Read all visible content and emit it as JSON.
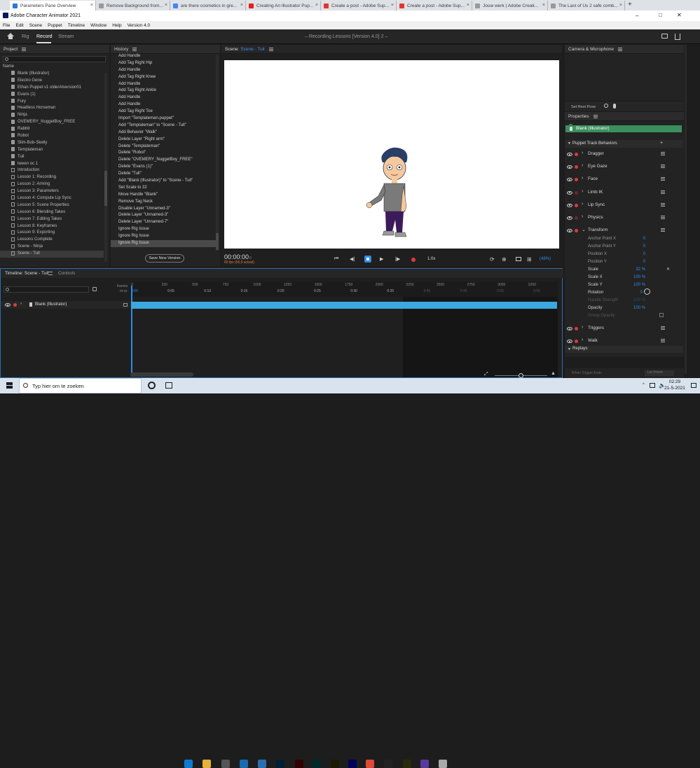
{
  "browser_tabs": [
    {
      "title": "Parameters Pane Overview",
      "color": "#2a7bd6"
    },
    {
      "title": "Remove Background from...",
      "color": "#999999"
    },
    {
      "title": "are there cosmetics in gre...",
      "color": "#4285f4"
    },
    {
      "title": "Creating An Illustrator Pup...",
      "color": "#e62117"
    },
    {
      "title": "Create a post - Adobe Sup...",
      "color": "#e3342f"
    },
    {
      "title": "Create a post - Adobe Sup...",
      "color": "#e3342f"
    },
    {
      "title": "Jouw werk | Adobe Creati...",
      "color": "#999999"
    },
    {
      "title": "The Last of Us 2 safe comb...",
      "color": "#999999"
    }
  ],
  "window": {
    "title": "Adobe Character Animator 2021",
    "controls": [
      "–",
      "□",
      "✕"
    ]
  },
  "menu": [
    "File",
    "Edit",
    "Scene",
    "Puppet",
    "Timeline",
    "Window",
    "Help",
    "Version 4.0"
  ],
  "modes": {
    "rig": "Rig",
    "record": "Record",
    "stream": "Stream"
  },
  "doc_title": "– Recording Lessons [Version 4.0] 2 –",
  "project": {
    "header": "Project",
    "col_name": "Name",
    "items": [
      "Blank (Illustrator)",
      "Electro Gene",
      "Ethan Puppet v1 olderAtversion01",
      "Evans (1)",
      "Fury",
      "Headless Horseman",
      "Ninja",
      "OVEMERY_NuggetBoy_FREE",
      "Rabbit",
      "Robot",
      "Slim-Bob-Skelly",
      "Templateman",
      "Tull",
      "tween oc 1",
      "Introduction",
      "Lesson 1: Recording",
      "Lesson 2: Arming",
      "Lesson 3: Parameters",
      "Lesson 4: Compute Lip Sync",
      "Lesson 5: Scene Properties",
      "Lesson 6: Blending Takes",
      "Lesson 7: Editing Takes",
      "Lesson 8: Keyframes",
      "Lesson 9: Exporting",
      "Lessons Complete",
      "Scene - Ninja",
      "Scene - Tull"
    ]
  },
  "history": {
    "header": "History",
    "items": [
      "Add Handle",
      "Add Tag Right Hip",
      "Add Handle",
      "Add Tag Right Knee",
      "Add Handle",
      "Add Tag Right Ankle",
      "Add Handle",
      "Add Handle",
      "Add Tag Right Toe",
      "Import \"Templateman.puppet\"",
      "Add \"Templateman\" to \"Scene - Tull\"",
      "Add Behavior \"Walk\"",
      "Delete Layer \"Right arm\"",
      "Delete \"Templateman\"",
      "Delete \"Robot\"",
      "Delete \"OVEMERY_NuggetBoy_FREE\"",
      "Delete \"Evans (1)\"",
      "Delete \"Tull\"",
      "Add \"Blank (Illustrator)\" to \"Scene - Tull\"",
      "Set Scale to 32",
      "Move Handle \"Blank\"",
      "Remove Tag Neck",
      "Disable Layer \"Unnamed-3\"",
      "Delete Layer \"Unnamed-3\"",
      "Delete Layer \"Unnamed-7\"",
      "Ignore Rig Issue",
      "Ignore Rig Issue",
      "Ignore Rig Issue"
    ],
    "save_button": "Save New Version"
  },
  "scene": {
    "label": "Scene:",
    "name": "Scene - Tull",
    "timecode": "00:00:00",
    "frame": "0",
    "fps": "60 fps (56,5 actual)",
    "speed": "1.0x",
    "zoom": "(48%)"
  },
  "camera": {
    "header": "Camera & Microphone",
    "rest_pose": "Set Rest Pose"
  },
  "properties": {
    "header": "Properties",
    "puppet_name": "Blank (Illustrator)",
    "section": "Puppet Track Behaviors",
    "behaviors": [
      "Dragger",
      "Eye Gaze",
      "Face",
      "Limb IK",
      "Lip Sync",
      "Physics",
      "Transform"
    ],
    "transform_params": [
      {
        "name": "Anchor Point X",
        "value": "0"
      },
      {
        "name": "Anchor Point Y",
        "value": "0"
      },
      {
        "name": "Position X",
        "value": "0"
      },
      {
        "name": "Position Y",
        "value": "0"
      },
      {
        "name": "Scale",
        "value": "32 %"
      },
      {
        "name": "Scale X",
        "value": "100 %"
      },
      {
        "name": "Scale Y",
        "value": "100 %"
      },
      {
        "name": "Rotation",
        "value": "0 °"
      },
      {
        "name": "Handle Strength",
        "value": "100 %"
      },
      {
        "name": "Opacity",
        "value": "100 %"
      },
      {
        "name": "Group Opacity",
        "value": ""
      }
    ],
    "more_behaviors": [
      "Triggers",
      "Walk"
    ],
    "replays_header": "Replays",
    "replay_when": "When Trigger Ends",
    "replay_select": "Let Finish"
  },
  "timeline": {
    "tab1": "Timeline: Scene - Tull",
    "tab2": "Controls",
    "frames_label": "frames",
    "ms_label": "m:ss",
    "frame_ticks": [
      "0",
      "250",
      "500",
      "750",
      "1000",
      "1250",
      "1500",
      "1750",
      "2000",
      "2250",
      "2500",
      "2750",
      "3000",
      "3250"
    ],
    "time_ticks": [
      "0:00",
      "0:05",
      "0:10",
      "0:15",
      "0:20",
      "0:25",
      "0:30",
      "0:35",
      "0:40",
      "0:45",
      "0:50",
      "0:55"
    ],
    "track_name": "Blank (Illustrator)"
  },
  "taskbar": {
    "search_placeholder": "Typ hier om te zoeken",
    "time": "02:29",
    "date": "21-5-2021",
    "apps": [
      "explorer-icon",
      "edge-icon",
      "file-explorer-icon",
      "store-icon",
      "mail-icon",
      "photos-icon",
      "photoshop-icon",
      "illustrator-icon",
      "animate-icon",
      "fresco-icon",
      "character-animator-icon",
      "chrome-icon",
      "xbox-icon",
      "dreamweaver-icon",
      "app-icon",
      "paint-icon"
    ]
  },
  "colors": {
    "accent": "#2d8ceb",
    "puppet_bar": "#3b8f5e",
    "track": "#3ba9e0",
    "record": "#e03a3a"
  }
}
